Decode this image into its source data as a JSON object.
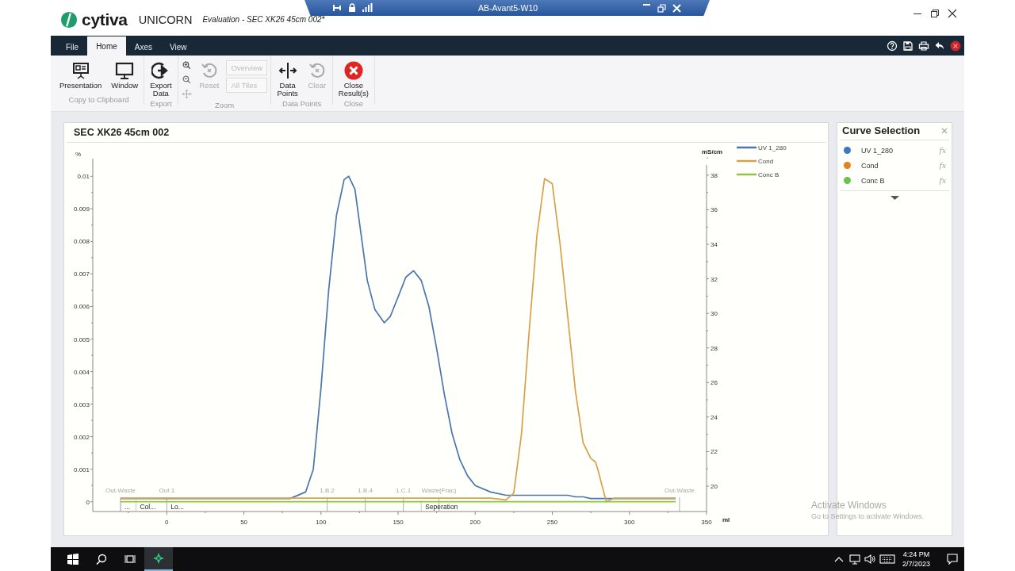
{
  "window": {
    "logo": "cytiva",
    "app_name": "UNICORN",
    "document_title": "Evaluation - SEC XK26 45cm 002*"
  },
  "remote_bar": {
    "title": "AB-Avant5-W10"
  },
  "menu_tabs": [
    {
      "label": "File",
      "selected": false
    },
    {
      "label": "Home",
      "selected": true
    },
    {
      "label": "Axes",
      "selected": false
    },
    {
      "label": "View",
      "selected": false
    }
  ],
  "ribbon_groups": [
    {
      "label": "Copy to Clipboard",
      "items": [
        {
          "kind": "large",
          "label": "Presentation",
          "disabled": false
        },
        {
          "kind": "large",
          "label": "Window",
          "disabled": false
        }
      ]
    },
    {
      "label": "Export",
      "items": [
        {
          "kind": "large",
          "label": "Export Data",
          "disabled": false
        }
      ]
    },
    {
      "label": "Zoom",
      "items": [
        {
          "kind": "icon",
          "disabled": false
        },
        {
          "kind": "icon",
          "disabled": false
        },
        {
          "kind": "icon",
          "disabled": true
        },
        {
          "kind": "large",
          "label": "Reset",
          "disabled": true
        },
        {
          "kind": "boxed",
          "label": "Overview",
          "disabled": true
        },
        {
          "kind": "boxed",
          "label": "All Tiles",
          "disabled": true
        }
      ]
    },
    {
      "label": "Data Points",
      "items": [
        {
          "kind": "large",
          "label": "Data Points",
          "disabled": false
        },
        {
          "kind": "large",
          "label": "Clear",
          "disabled": true
        }
      ]
    },
    {
      "label": "Close",
      "items": [
        {
          "kind": "large",
          "label": "Close Result(s)",
          "disabled": false
        }
      ]
    }
  ],
  "chart_panel": {
    "title": "SEC XK26 45cm 002",
    "chart_data": {
      "type": "line",
      "xlabel": "ml",
      "ylabel": "%",
      "y2label": "mS/cm",
      "x": [
        -30,
        -20,
        0,
        20,
        50,
        80,
        90,
        95,
        100,
        105,
        110,
        115,
        118,
        122,
        126,
        130,
        135,
        141,
        145,
        150,
        155,
        160,
        165,
        170,
        175,
        180,
        185,
        190,
        195,
        200,
        210,
        220,
        225,
        230,
        235,
        240,
        245,
        250,
        255,
        260,
        265,
        270,
        275,
        278,
        280,
        282,
        285,
        290,
        300,
        320,
        330
      ],
      "xlim": [
        -48,
        350
      ],
      "ylim": [
        -0.0003,
        0.0103
      ],
      "y2lim": [
        18.53,
        38.5
      ],
      "xticks": [
        0,
        50,
        100,
        150,
        200,
        250,
        300,
        350
      ],
      "yticks": [
        0,
        0.001,
        0.002,
        0.003,
        0.004,
        0.005,
        0.006,
        0.007,
        0.008,
        0.009,
        0.01
      ],
      "y2ticks": [
        20,
        22,
        24,
        26,
        28,
        30,
        32,
        34,
        36,
        38
      ],
      "series": [
        {
          "name": "UV 1_280",
          "color": "#4a76ad",
          "values": [
            0.0001,
            0.0001,
            0.0001,
            0.0001,
            0.0001,
            0.0001,
            0.0003,
            0.001,
            0.0035,
            0.0065,
            0.0088,
            0.0099,
            0.01,
            0.0096,
            0.0082,
            0.0068,
            0.0059,
            0.0055,
            0.0057,
            0.0063,
            0.0069,
            0.0071,
            0.0068,
            0.006,
            0.0047,
            0.0033,
            0.0021,
            0.0013,
            0.0008,
            0.0005,
            0.0003,
            0.0002,
            0.0002,
            0.0002,
            0.0002,
            0.0002,
            0.0002,
            0.0002,
            0.0002,
            0.0002,
            0.00015,
            0.00015,
            0.0001,
            0.0001,
            0.0001,
            0.0001,
            0.0001,
            0.0001,
            0.0001,
            0.0001,
            0.0001
          ]
        },
        {
          "name": "Cond",
          "color": "#d9a04c",
          "axis": "y2",
          "values": [
            19.3,
            19.3,
            19.3,
            19.3,
            19.3,
            19.3,
            19.3,
            19.3,
            19.3,
            19.3,
            19.3,
            19.3,
            19.3,
            19.3,
            19.3,
            19.3,
            19.3,
            19.3,
            19.3,
            19.3,
            19.3,
            19.3,
            19.3,
            19.3,
            19.3,
            19.3,
            19.3,
            19.3,
            19.3,
            19.3,
            19.3,
            19.2,
            19.6,
            23,
            29,
            34.5,
            37.8,
            37.5,
            34,
            29.8,
            25.5,
            22.5,
            21.6,
            21.4,
            20.8,
            20.1,
            19.1,
            19.3,
            19.3,
            19.3,
            19.3
          ]
        },
        {
          "name": "Conc B",
          "color": "#8cc63f",
          "values": [
            0,
            0,
            0,
            0,
            0,
            0,
            0,
            0,
            0,
            0,
            0,
            0,
            0,
            0,
            0,
            0,
            0,
            0,
            0,
            0,
            0,
            0,
            0,
            0,
            0,
            0,
            0,
            0,
            0,
            0,
            0,
            0,
            0,
            0,
            0,
            0,
            0,
            0,
            0,
            0,
            0,
            0,
            0,
            0,
            0,
            0,
            0,
            0,
            0,
            0,
            0
          ]
        }
      ],
      "legend": "upper right",
      "annotations": [
        "Out-Waste",
        "Out 1",
        "1.B.2",
        "1.B.4",
        "1.C.1",
        "Waste(Frac)",
        "Out-Waste",
        "...",
        "Col...",
        "Lo...",
        "Seperation"
      ]
    }
  },
  "curve_selection": {
    "title": "Curve Selection",
    "items": [
      {
        "name": "UV 1_280",
        "color": "#3f77c0",
        "function_label": "fx"
      },
      {
        "name": "Cond",
        "color": "#e8801a",
        "function_label": "fx"
      },
      {
        "name": "Conc B",
        "color": "#6cc24a",
        "function_label": "fx"
      }
    ]
  },
  "activation_notice": {
    "title": "Activate Windows",
    "subtitle": "Go to Settings to activate Windows."
  },
  "taskbar": {
    "time": "4:24 PM",
    "date": "2/7/2023"
  }
}
